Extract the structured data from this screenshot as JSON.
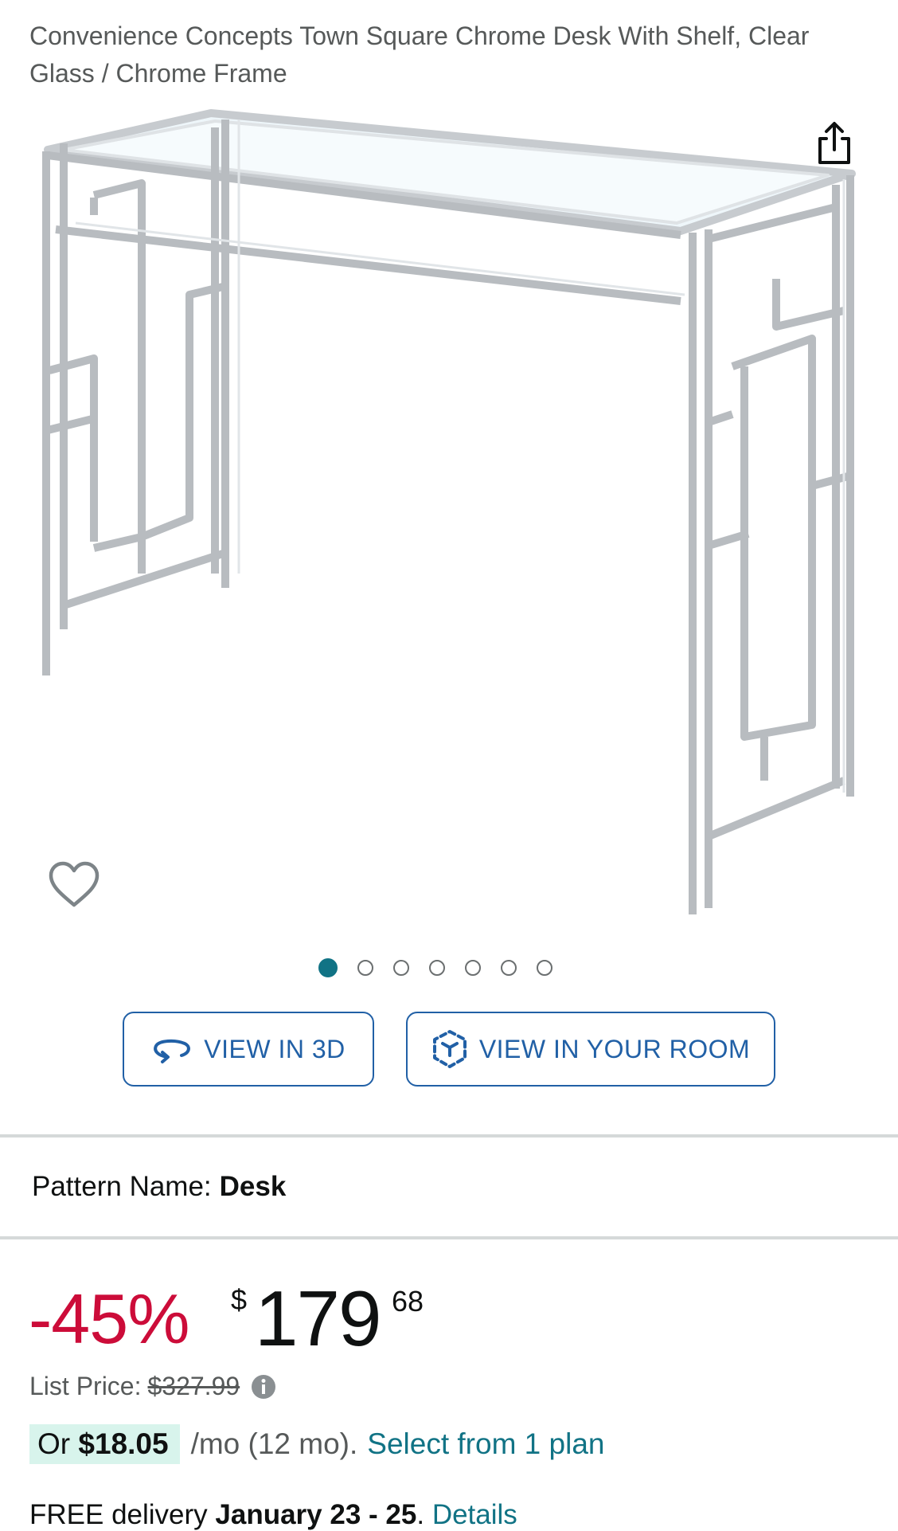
{
  "product": {
    "title": "Convenience Concepts Town Square Chrome Desk With Shelf, Clear Glass / Chrome Frame"
  },
  "gallery": {
    "image_count": 7,
    "active_index": 0
  },
  "buttons": {
    "view_3d": "VIEW IN 3D",
    "view_room": "VIEW IN YOUR ROOM"
  },
  "pattern": {
    "label": "Pattern Name:",
    "value": "Desk"
  },
  "price": {
    "discount": "-45%",
    "currency": "$",
    "whole": "179",
    "fraction": "68",
    "list_price_label": "List Price:",
    "list_price_value": "$327.99"
  },
  "financing": {
    "prefix": "Or",
    "amount": "$18.05",
    "term": "/mo (12 mo).",
    "link": "Select from 1 plan"
  },
  "delivery": {
    "label": "FREE delivery",
    "dates": "January 23 - 25",
    "sep": ".",
    "link": "Details"
  },
  "icons": {
    "share": "share-icon",
    "wishlist": "heart-icon",
    "view_3d": "rotate-3d-icon",
    "view_room": "ar-cube-icon",
    "info": "info-icon"
  },
  "colors": {
    "discount": "#cc0c39",
    "link": "#117385",
    "button_border": "#2160a6",
    "active_dot": "#117385",
    "financing_bg": "#d8f4ec"
  }
}
